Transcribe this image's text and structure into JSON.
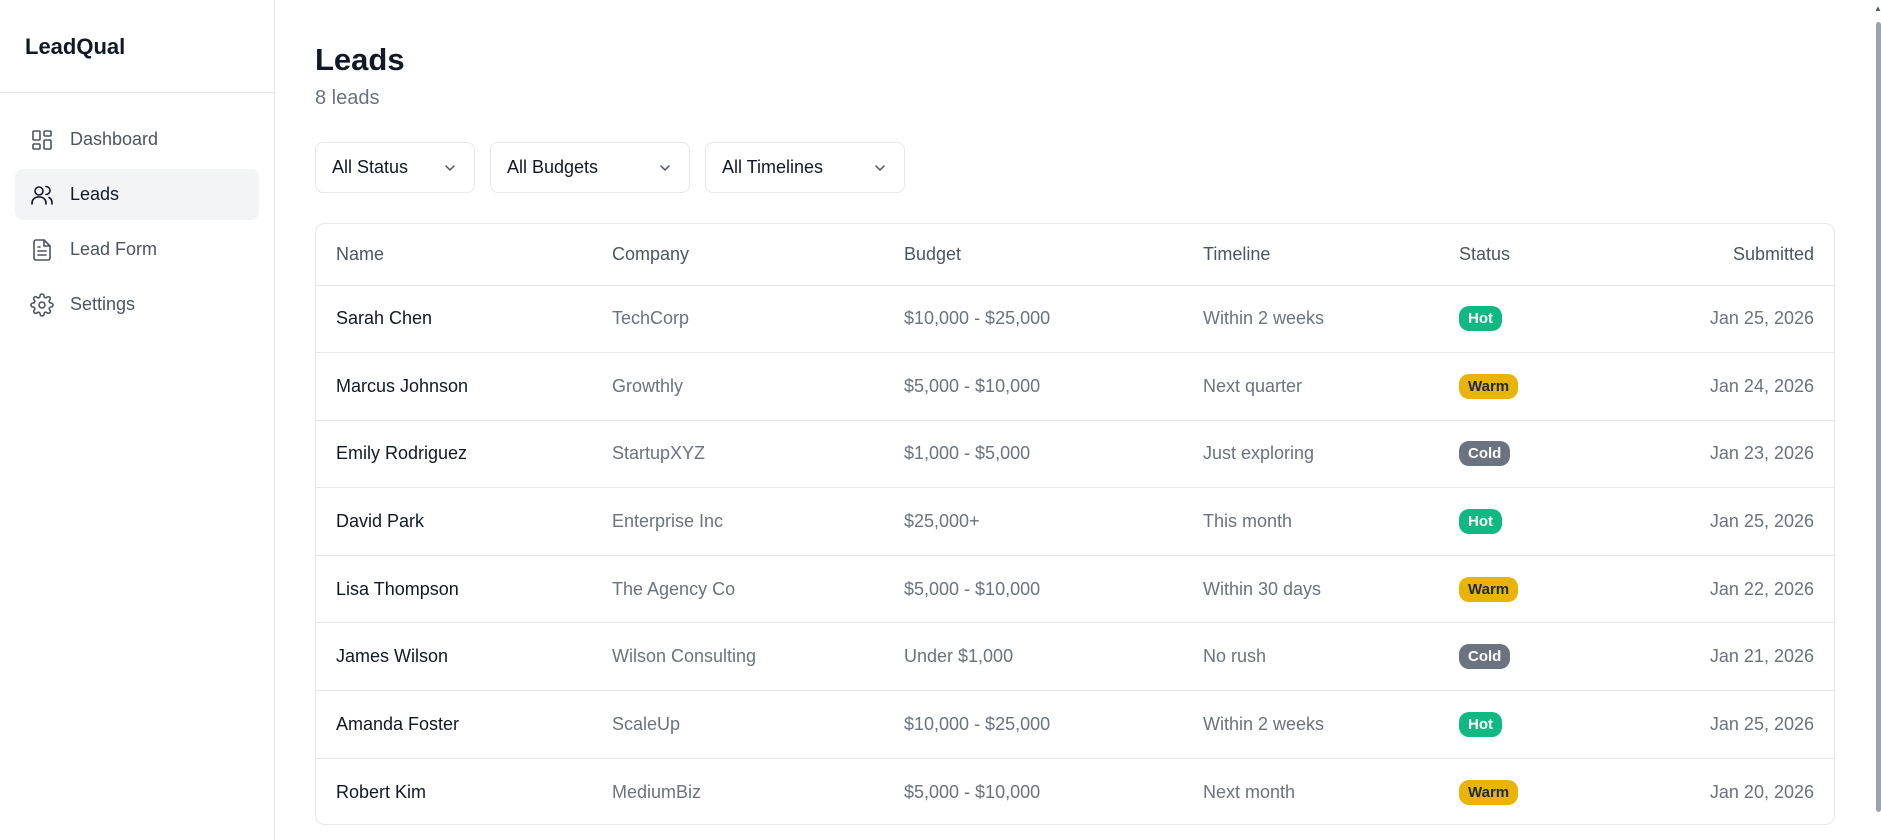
{
  "app": {
    "brand": "LeadQual"
  },
  "sidebar": {
    "items": [
      {
        "label": "Dashboard",
        "icon": "dashboard-icon",
        "active": false
      },
      {
        "label": "Leads",
        "icon": "users-icon",
        "active": true
      },
      {
        "label": "Lead Form",
        "icon": "document-icon",
        "active": false
      },
      {
        "label": "Settings",
        "icon": "gear-icon",
        "active": false
      }
    ]
  },
  "header": {
    "title": "Leads",
    "subtitle": "8 leads"
  },
  "filters": {
    "status": "All Status",
    "budget": "All Budgets",
    "timeline": "All Timelines"
  },
  "table": {
    "columns": [
      "Name",
      "Company",
      "Budget",
      "Timeline",
      "Status",
      "Submitted"
    ],
    "rows": [
      {
        "name": "Sarah Chen",
        "company": "TechCorp",
        "budget": "$10,000 - $25,000",
        "timeline": "Within 2 weeks",
        "status": "Hot",
        "submitted": "Jan 25, 2026"
      },
      {
        "name": "Marcus Johnson",
        "company": "Growthly",
        "budget": "$5,000 - $10,000",
        "timeline": "Next quarter",
        "status": "Warm",
        "submitted": "Jan 24, 2026"
      },
      {
        "name": "Emily Rodriguez",
        "company": "StartupXYZ",
        "budget": "$1,000 - $5,000",
        "timeline": "Just exploring",
        "status": "Cold",
        "submitted": "Jan 23, 2026"
      },
      {
        "name": "David Park",
        "company": "Enterprise Inc",
        "budget": "$25,000+",
        "timeline": "This month",
        "status": "Hot",
        "submitted": "Jan 25, 2026"
      },
      {
        "name": "Lisa Thompson",
        "company": "The Agency Co",
        "budget": "$5,000 - $10,000",
        "timeline": "Within 30 days",
        "status": "Warm",
        "submitted": "Jan 22, 2026"
      },
      {
        "name": "James Wilson",
        "company": "Wilson Consulting",
        "budget": "Under $1,000",
        "timeline": "No rush",
        "status": "Cold",
        "submitted": "Jan 21, 2026"
      },
      {
        "name": "Amanda Foster",
        "company": "ScaleUp",
        "budget": "$10,000 - $25,000",
        "timeline": "Within 2 weeks",
        "status": "Hot",
        "submitted": "Jan 25, 2026"
      },
      {
        "name": "Robert Kim",
        "company": "MediumBiz",
        "budget": "$5,000 - $10,000",
        "timeline": "Next month",
        "status": "Warm",
        "submitted": "Jan 20, 2026"
      }
    ]
  },
  "colors": {
    "hot": "#10b981",
    "warm": "#eab308",
    "cold": "#6b7280",
    "active_nav_bg": "#f3f4f6",
    "border": "#e5e7eb"
  }
}
